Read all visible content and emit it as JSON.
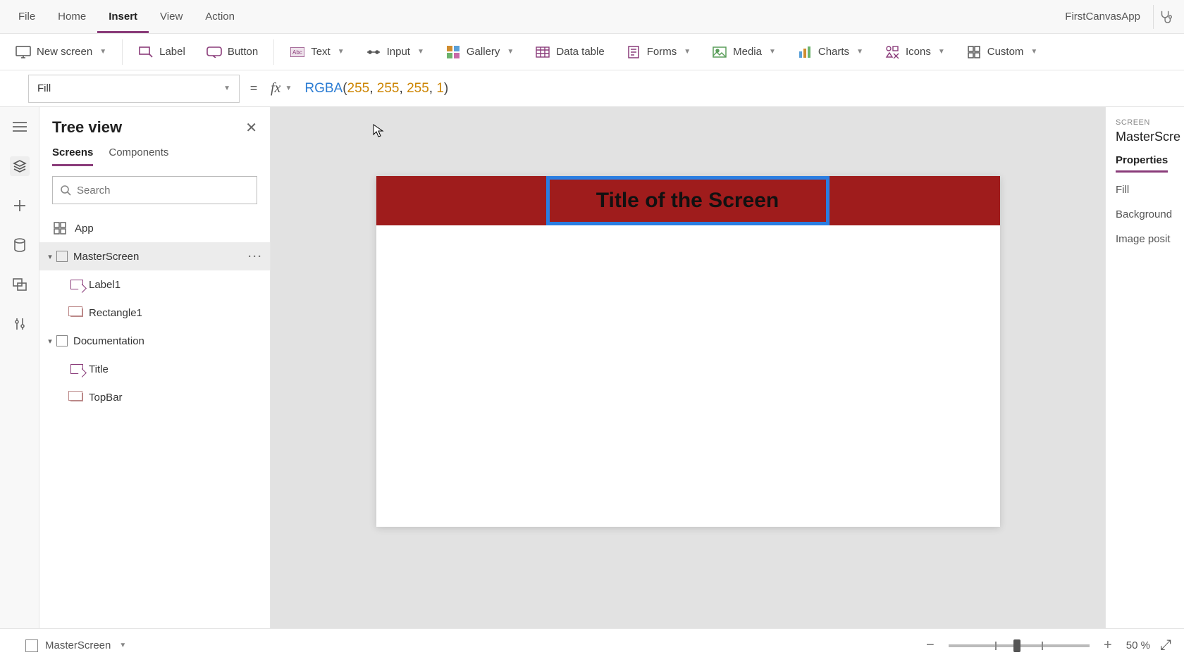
{
  "app_name": "FirstCanvasApp",
  "menu": {
    "items": [
      "File",
      "Home",
      "Insert",
      "View",
      "Action"
    ],
    "active": "Insert"
  },
  "ribbon": {
    "new_screen": "New screen",
    "label": "Label",
    "button": "Button",
    "text": "Text",
    "input": "Input",
    "gallery": "Gallery",
    "data_table": "Data table",
    "forms": "Forms",
    "media": "Media",
    "charts": "Charts",
    "icons": "Icons",
    "custom": "Custom"
  },
  "formula": {
    "property": "Fill",
    "fn": "RGBA",
    "args": [
      "255",
      "255",
      "255",
      "1"
    ]
  },
  "tree": {
    "title": "Tree view",
    "tabs": {
      "screens": "Screens",
      "components": "Components",
      "active": "Screens"
    },
    "search_placeholder": "Search",
    "app": "App",
    "nodes": [
      {
        "name": "MasterScreen",
        "selected": true,
        "children": [
          {
            "name": "Label1",
            "kind": "label"
          },
          {
            "name": "Rectangle1",
            "kind": "rect"
          }
        ]
      },
      {
        "name": "Documentation",
        "children": [
          {
            "name": "Title",
            "kind": "label"
          },
          {
            "name": "TopBar",
            "kind": "rect"
          }
        ]
      }
    ]
  },
  "canvas": {
    "title_text": "Title of the Screen"
  },
  "right": {
    "category": "SCREEN",
    "name": "MasterScre",
    "tab": "Properties",
    "rows": [
      "Fill",
      "Background",
      "Image posit"
    ]
  },
  "status": {
    "screen": "MasterScreen",
    "zoom": "50",
    "unit": "%"
  }
}
